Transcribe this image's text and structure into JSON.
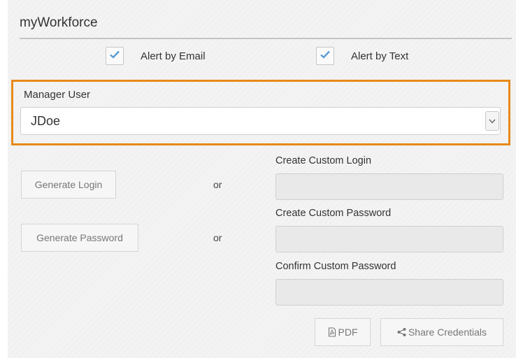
{
  "section": {
    "title": "myWorkforce"
  },
  "alerts": {
    "email_label": "Alert by Email",
    "email_checked": true,
    "text_label": "Alert by Text",
    "text_checked": true
  },
  "manager": {
    "label": "Manager User",
    "value": "JDoe"
  },
  "credentials": {
    "generate_login_label": "Generate Login",
    "generate_password_label": "Generate Password",
    "or_text": "or",
    "custom_login_label": "Create Custom Login",
    "custom_login_value": "",
    "custom_password_label": "Create Custom Password",
    "custom_password_value": "",
    "confirm_password_label": "Confirm Custom Password",
    "confirm_password_value": "",
    "pdf_label": "PDF",
    "share_label": "Share Credentials"
  },
  "colors": {
    "highlight": "#e8891a",
    "check": "#5b9bd5",
    "panel_bg": "#f3f3f3"
  },
  "icons": [
    "check-icon",
    "chevron-down-icon",
    "pdf-icon",
    "share-icon"
  ]
}
